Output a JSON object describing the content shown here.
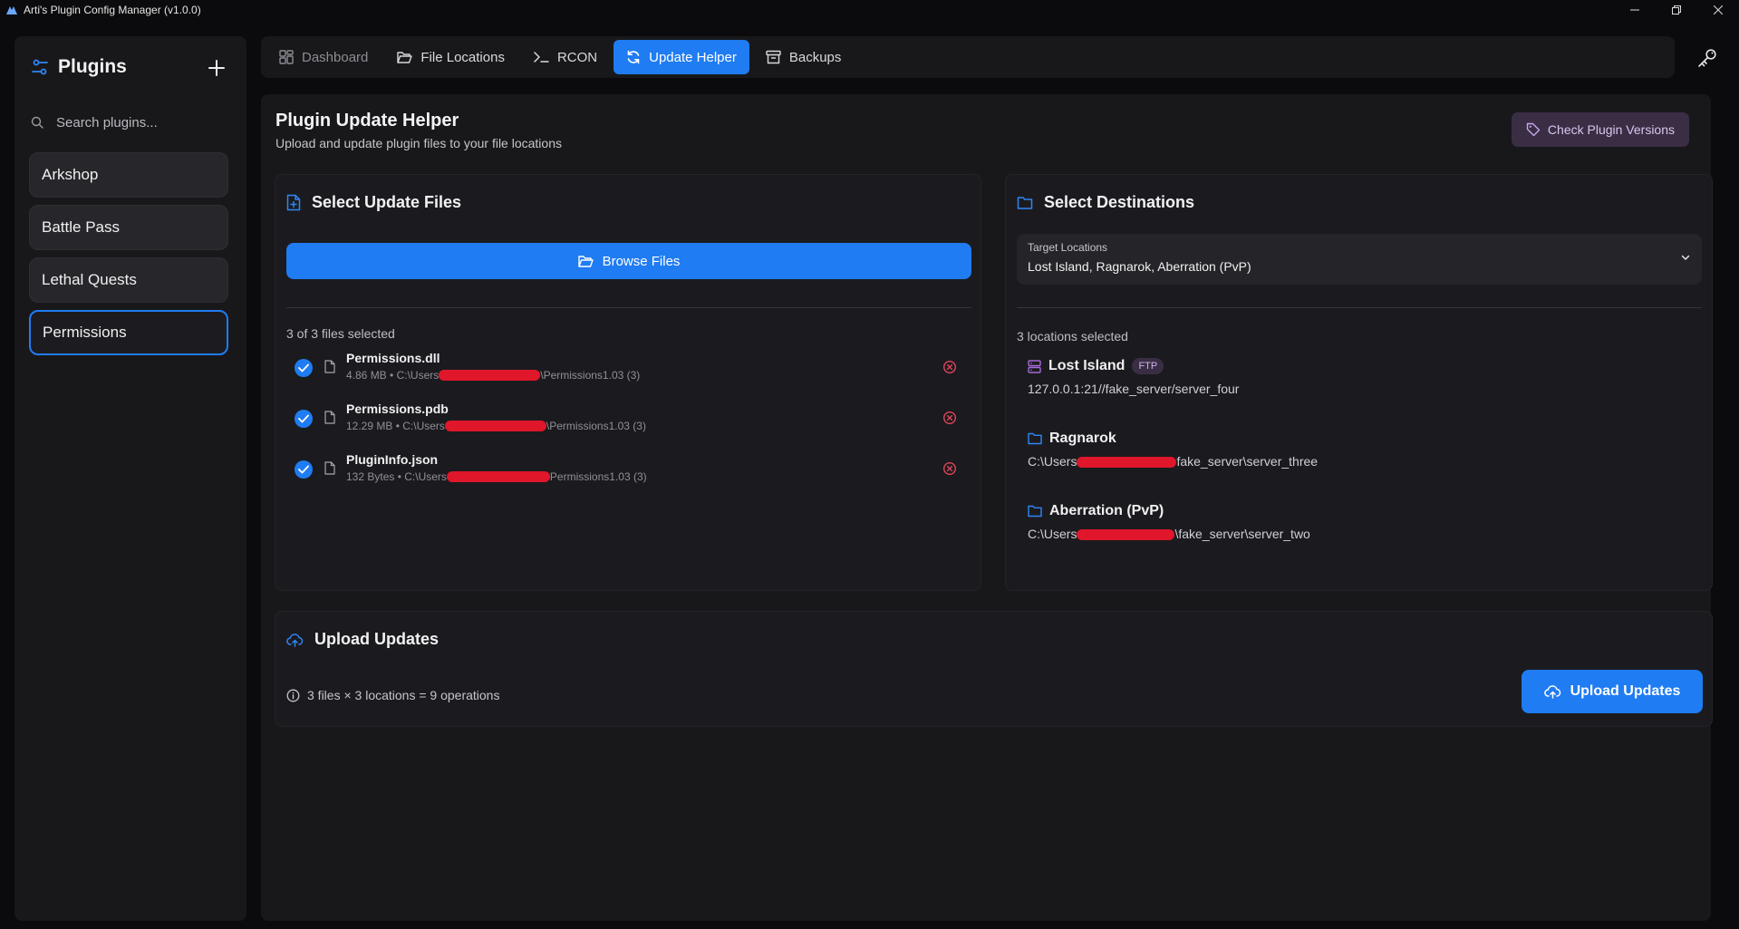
{
  "window": {
    "title": "Arti's Plugin Config Manager (v1.0.0)"
  },
  "sidebar": {
    "title": "Plugins",
    "search_placeholder": "Search plugins...",
    "items": [
      {
        "label": "Arkshop"
      },
      {
        "label": "Battle Pass"
      },
      {
        "label": "Lethal Quests"
      },
      {
        "label": "Permissions"
      }
    ]
  },
  "nav": {
    "tabs": [
      {
        "label": "Dashboard"
      },
      {
        "label": "File Locations"
      },
      {
        "label": "RCON"
      },
      {
        "label": "Update Helper"
      },
      {
        "label": "Backups"
      }
    ]
  },
  "page": {
    "title": "Plugin Update Helper",
    "subtitle": "Upload and update plugin files to your file locations",
    "check_versions_label": "Check Plugin Versions"
  },
  "files_card": {
    "title": "Select Update Files",
    "browse_label": "Browse Files",
    "count_text": "3 of 3 files selected",
    "files": [
      {
        "name": "Permissions.dll",
        "size": "4.86 MB",
        "path_prefix": "C:\\Users",
        "path_suffix": "\\Permissions1.03 (3)"
      },
      {
        "name": "Permissions.pdb",
        "size": "12.29 MB",
        "path_prefix": "C:\\Users",
        "path_suffix": "\\Permissions1.03 (3)"
      },
      {
        "name": "PluginInfo.json",
        "size": "132 Bytes",
        "path_prefix": "C:\\Users",
        "path_suffix": "Permissions1.03 (3)"
      }
    ]
  },
  "dest_card": {
    "title": "Select Destinations",
    "dropdown_label": "Target Locations",
    "dropdown_value": "Lost Island, Ragnarok, Aberration (PvP)",
    "count_text": "3 locations selected",
    "locations": [
      {
        "name": "Lost Island",
        "badge": "FTP",
        "path_prefix": "127.0.0.1:21//fake_server/server_four",
        "path_suffix": ""
      },
      {
        "name": "Ragnarok",
        "badge": "",
        "path_prefix": "C:\\Users",
        "path_suffix": "fake_server\\server_three"
      },
      {
        "name": "Aberration (PvP)",
        "badge": "",
        "path_prefix": "C:\\Users",
        "path_suffix": "\\fake_server\\server_two"
      }
    ]
  },
  "upload_card": {
    "title": "Upload Updates",
    "ops_text": "3 files × 3 locations = 9 operations",
    "upload_label": "Upload Updates"
  },
  "colors": {
    "accent": "#1f7cf2",
    "danger": "#e0445a",
    "purple": "#a66bd9"
  },
  "icons": {
    "sidebar_header": "sliders-icon",
    "add": "plus-icon",
    "search": "search-icon",
    "key": "key-icon",
    "tag": "tag-icon",
    "file_plus": "file-plus-icon",
    "folder": "folder-icon",
    "folder_open": "folder-open-icon",
    "file": "file-icon",
    "remove": "x-circle-icon",
    "server": "server-icon",
    "chevron": "chevron-down-icon",
    "upload": "cloud-upload-icon",
    "info": "info-icon"
  }
}
